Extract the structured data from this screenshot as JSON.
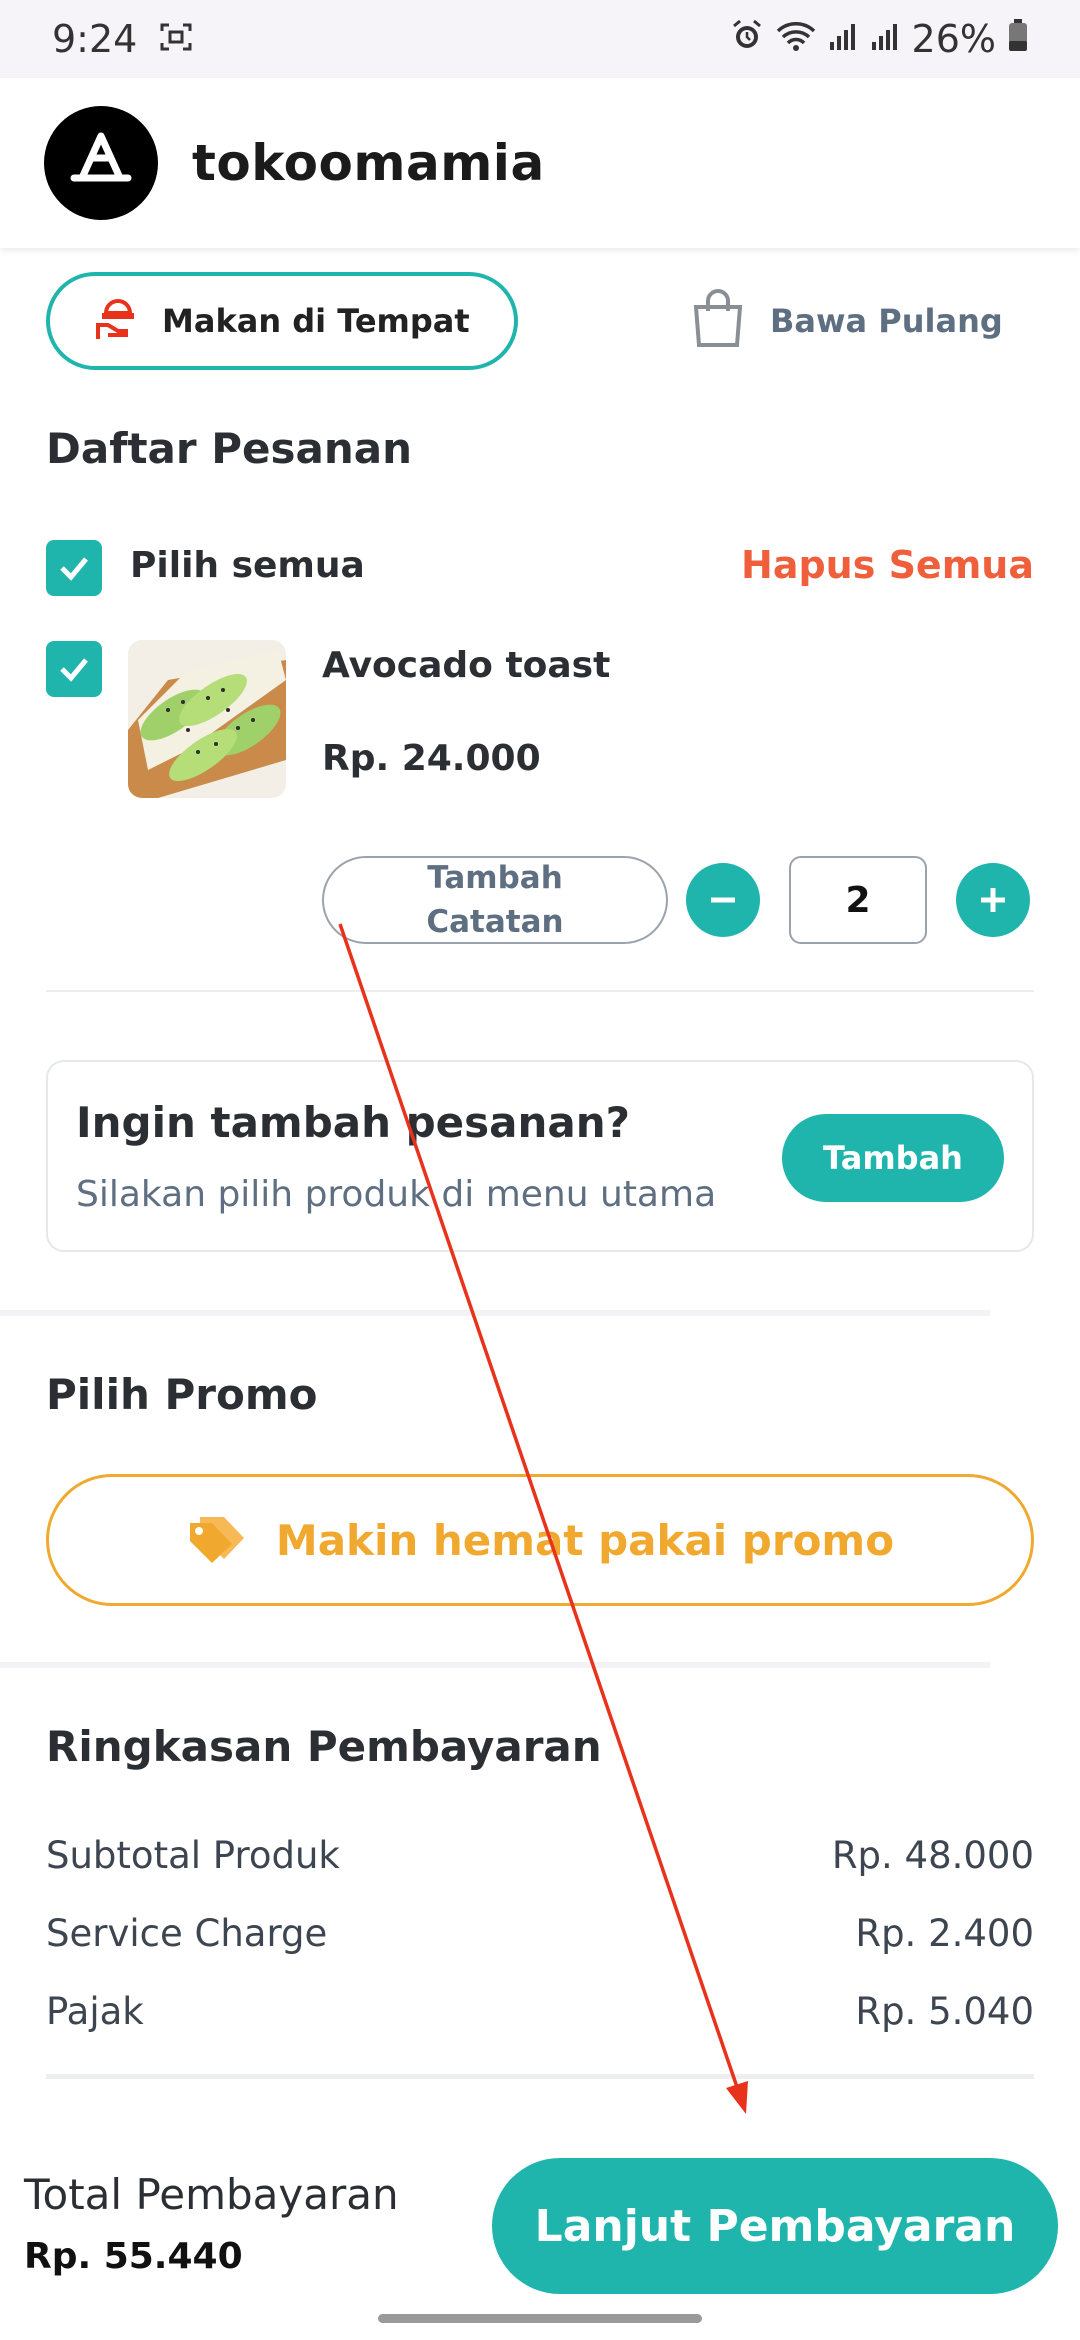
{
  "status_bar": {
    "time": "9:24",
    "battery": "26%",
    "icons": [
      "screenshot-icon",
      "alarm-icon",
      "wifi-icon",
      "signal-icon",
      "signal-icon",
      "battery-icon"
    ]
  },
  "header": {
    "brand": "tokoomamia",
    "logo_icon": "app-store-icon"
  },
  "order_type": {
    "dine_in": "Makan di Tempat",
    "take_away": "Bawa Pulang",
    "selected": "dine_in"
  },
  "order_list": {
    "title": "Daftar Pesanan",
    "select_all": "Pilih semua",
    "delete_all": "Hapus Semua",
    "items": [
      {
        "name": "Avocado toast",
        "price": "Rp. 24.000",
        "note_button": [
          "Tambah",
          "Catatan"
        ],
        "quantity": "2",
        "checked": true
      }
    ]
  },
  "add_more": {
    "title": "Ingin tambah pesanan?",
    "subtitle": "Silakan pilih produk di menu utama",
    "button": "Tambah"
  },
  "promo": {
    "title": "Pilih Promo",
    "button": "Makin hemat pakai promo"
  },
  "summary": {
    "title": "Ringkasan Pembayaran",
    "rows": [
      {
        "label": "Subtotal Produk",
        "value": "Rp. 48.000"
      },
      {
        "label": "Service Charge",
        "value": "Rp. 2.400"
      },
      {
        "label": "Pajak",
        "value": "Rp. 5.040"
      }
    ]
  },
  "footer": {
    "total_label": "Total Pembayaran",
    "total_value": "Rp. 55.440",
    "pay_button": "Lanjut Pembayaran"
  },
  "colors": {
    "accent": "#1fb5ad",
    "danger": "#ef5f3c",
    "promo": "#f0a92e",
    "annotation": "#e8321c"
  }
}
